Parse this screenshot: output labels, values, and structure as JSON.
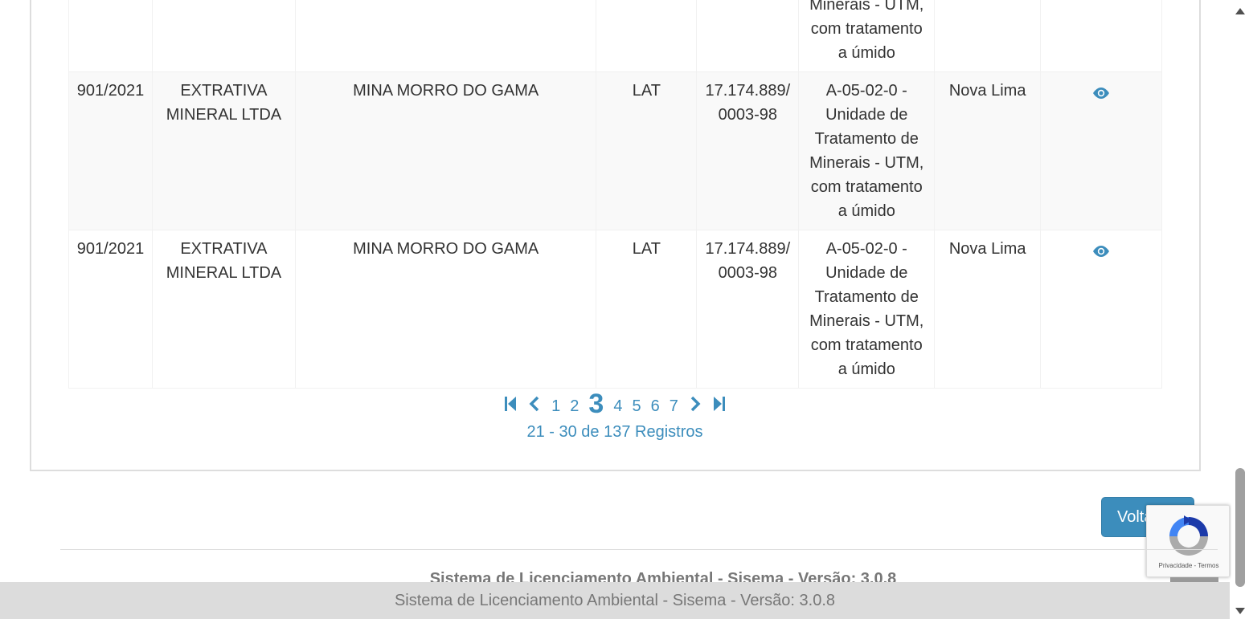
{
  "partial_row": {
    "activity": "Minerais - UTM,\ncom tratamento\na úmido"
  },
  "rows": [
    {
      "number": "901/2021",
      "company": "EXTRATIVA MINERAL LTDA",
      "enterprise": "MINA MORRO DO GAMA",
      "modality": "LAT",
      "cnpj": "17.174.889/ 0003-98",
      "activity": "A-05-02-0 - Unidade de Tratamento de Minerais - UTM, com tratamento a úmido",
      "city": "Nova Lima",
      "action_icon": "eye-icon"
    },
    {
      "number": "901/2021",
      "company": "EXTRATIVA MINERAL LTDA",
      "enterprise": "MINA MORRO DO GAMA",
      "modality": "LAT",
      "cnpj": "17.174.889/ 0003-98",
      "activity": "A-05-02-0 - Unidade de Tratamento de Minerais - UTM, com tratamento a úmido",
      "city": "Nova Lima",
      "action_icon": "eye-icon"
    }
  ],
  "pagination": {
    "pages": [
      "1",
      "2",
      "3",
      "4",
      "5",
      "6",
      "7"
    ],
    "current_page": "3",
    "records_text": "21 - 30 de 137 Registros"
  },
  "buttons": {
    "voltar_label": "Voltar"
  },
  "recaptcha": {
    "privacy": "Privacidade",
    "separator": " - ",
    "terms": "Termos"
  },
  "footer": {
    "text": "Sistema de Licenciamento Ambiental - Sisema - Versão: 3.0.8",
    "fixed_text": "Sistema de Licenciamento Ambiental - Sisema - Versão: 3.0.8"
  },
  "colors": {
    "accent": "#3c8dbc",
    "footer_bg": "#dcdcdc"
  }
}
